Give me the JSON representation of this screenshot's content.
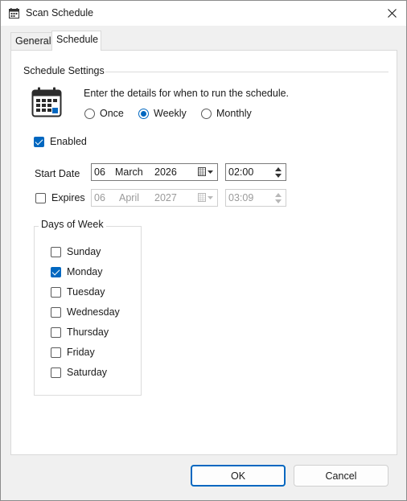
{
  "window": {
    "title": "Scan Schedule"
  },
  "tabs": [
    {
      "label": "General",
      "active": false
    },
    {
      "label": "Schedule",
      "active": true
    }
  ],
  "schedule_settings": {
    "heading": "Schedule Settings",
    "hint": "Enter the details for when to run the schedule.",
    "frequency_options": [
      {
        "label": "Once",
        "checked": false
      },
      {
        "label": "Weekly",
        "checked": true
      },
      {
        "label": "Monthly",
        "checked": false
      }
    ]
  },
  "enabled": {
    "label": "Enabled",
    "checked": true
  },
  "start_date": {
    "label": "Start Date",
    "day": "06",
    "month": "March",
    "year": "2026",
    "time": "02:00"
  },
  "expires": {
    "label": "Expires",
    "checked": false,
    "day": "06",
    "month": "April",
    "year": "2027",
    "time": "03:09"
  },
  "days_of_week": {
    "title": "Days of Week",
    "days": [
      {
        "label": "Sunday",
        "checked": false
      },
      {
        "label": "Monday",
        "checked": true
      },
      {
        "label": "Tuesday",
        "checked": false
      },
      {
        "label": "Wednesday",
        "checked": false
      },
      {
        "label": "Thursday",
        "checked": false
      },
      {
        "label": "Friday",
        "checked": false
      },
      {
        "label": "Saturday",
        "checked": false
      }
    ]
  },
  "buttons": {
    "ok": "OK",
    "cancel": "Cancel"
  },
  "colors": {
    "accent": "#0067c0",
    "window_bg": "#f0f0f0",
    "panel_bg": "#ffffff"
  },
  "icons": {
    "title": "calendar-icon",
    "schedule": "calendar-icon",
    "close": "close-icon",
    "date_picker": "calendar-dropdown-icon"
  }
}
